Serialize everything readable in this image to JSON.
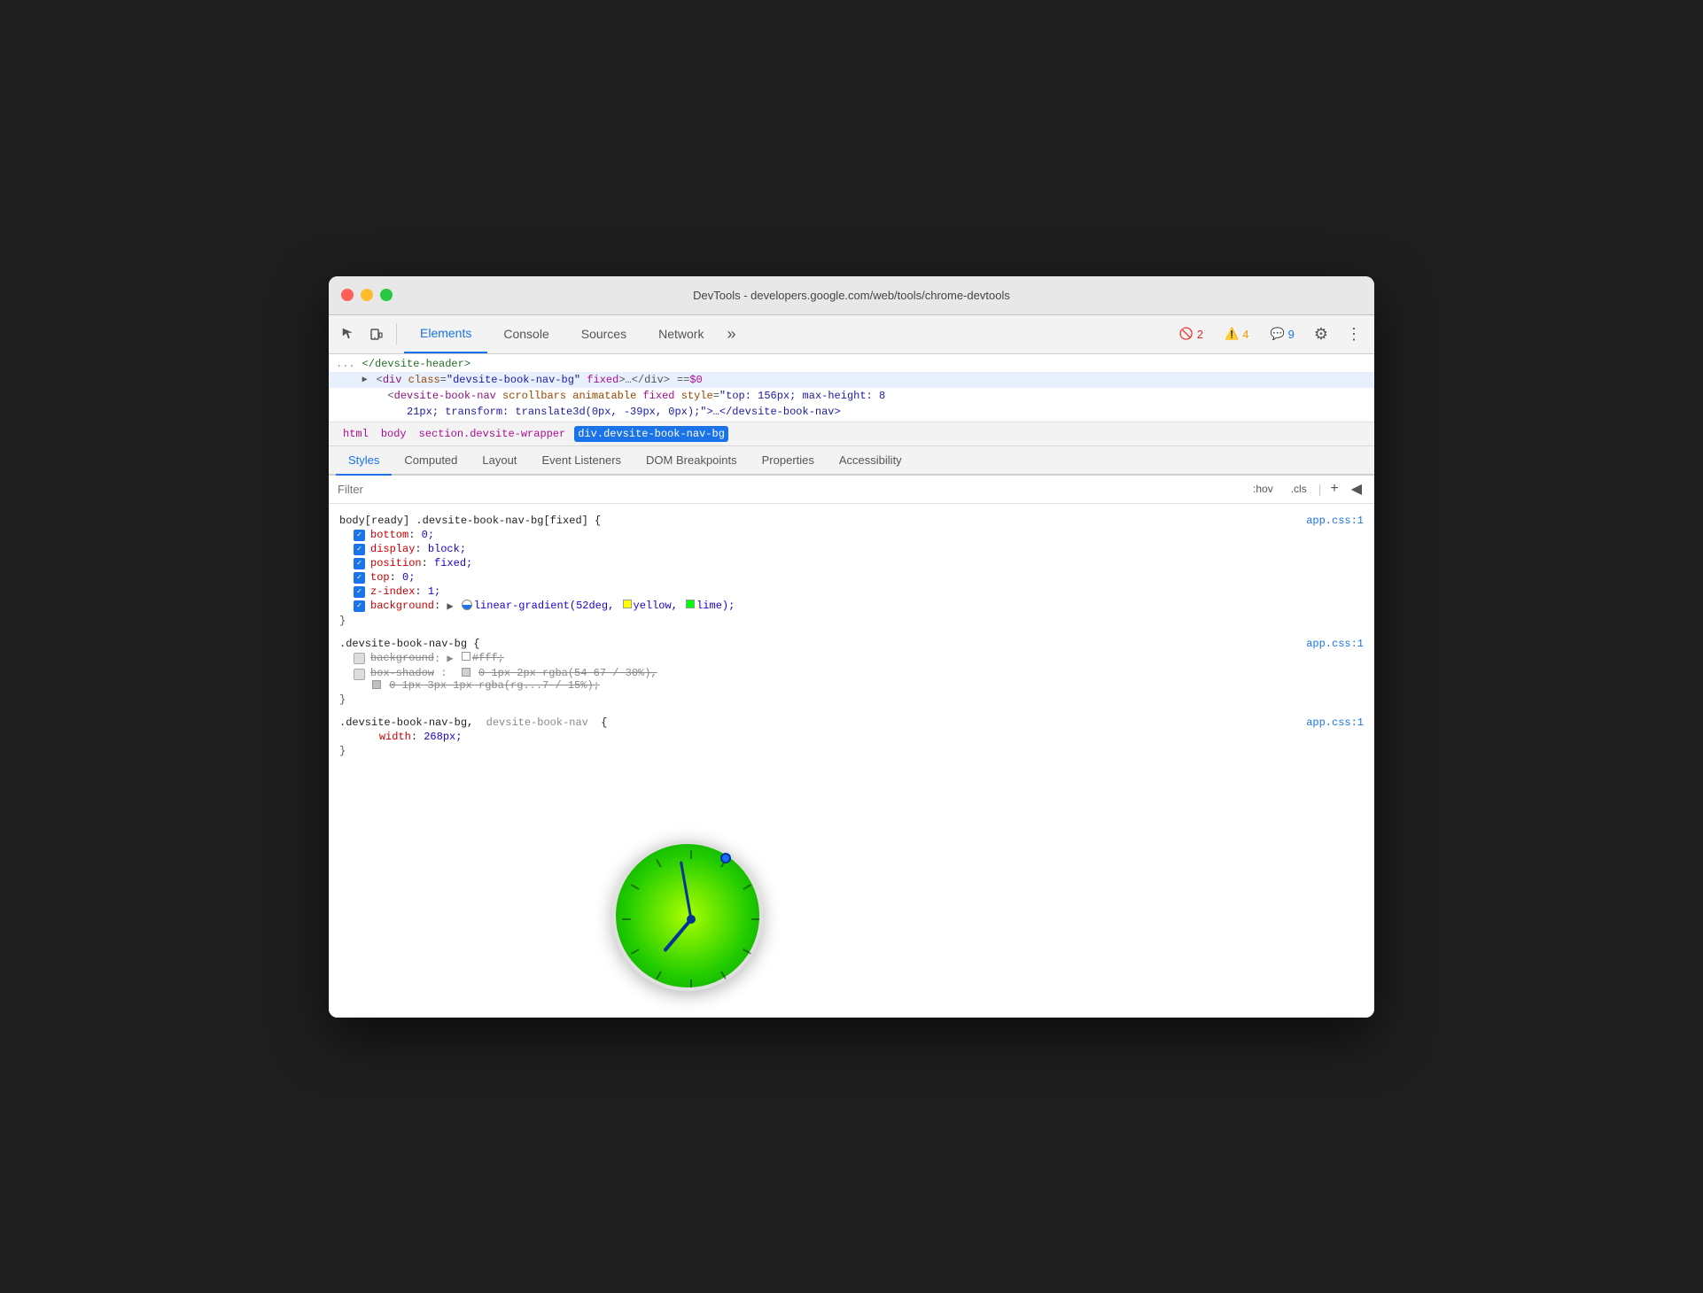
{
  "window": {
    "title": "DevTools - developers.google.com/web/tools/chrome-devtools"
  },
  "toolbar": {
    "tabs": [
      {
        "id": "elements",
        "label": "Elements",
        "active": true
      },
      {
        "id": "console",
        "label": "Console",
        "active": false
      },
      {
        "id": "sources",
        "label": "Sources",
        "active": false
      },
      {
        "id": "network",
        "label": "Network",
        "active": false
      }
    ],
    "more_label": "»",
    "errors_count": "2",
    "warnings_count": "4",
    "messages_count": "9",
    "settings_icon": "⚙",
    "more_icon": "⋮"
  },
  "html_panel": {
    "line1": "</devsite-header>",
    "line2_prefix": "▶",
    "line2_tag": "div",
    "line2_attr": "class",
    "line2_val": "devsite-book-nav-bg",
    "line2_keyword": "fixed",
    "line2_comment": "…</div>",
    "line2_eq": "== $0",
    "line3_tag": "devsite-book-nav",
    "line3_attrs": "scrollbars animatable fixed",
    "line3_style_attr": "style",
    "line3_style_val": "\"top: 156px; max-height: 8",
    "line4": "21px; transform: translate3d(0px, -39px, 0px);\">…</devsite-book-nav>"
  },
  "breadcrumb": {
    "items": [
      {
        "label": "html",
        "selected": false
      },
      {
        "label": "body",
        "selected": false
      },
      {
        "label": "section.devsite-wrapper",
        "selected": false
      },
      {
        "label": "div.devsite-book-nav-bg",
        "selected": true
      }
    ]
  },
  "sub_tabs": {
    "tabs": [
      {
        "label": "Styles",
        "active": true
      },
      {
        "label": "Computed",
        "active": false
      },
      {
        "label": "Layout",
        "active": false
      },
      {
        "label": "Event Listeners",
        "active": false
      },
      {
        "label": "DOM Breakpoints",
        "active": false
      },
      {
        "label": "Properties",
        "active": false
      },
      {
        "label": "Accessibility",
        "active": false
      }
    ]
  },
  "filter_bar": {
    "placeholder": "Filter",
    "hov_label": ":hov",
    "cls_label": ".cls",
    "plus_label": "+",
    "arrow_label": "◀"
  },
  "css_rules": [
    {
      "selector": "body[ready] .devsite-book-nav-bg[fixed] {",
      "source": "app.css:1",
      "properties": [
        {
          "checked": true,
          "name": "bottom",
          "value": "0;"
        },
        {
          "checked": true,
          "name": "display",
          "value": "block;"
        },
        {
          "checked": true,
          "name": "position",
          "value": "fixed;"
        },
        {
          "checked": true,
          "name": "top",
          "value": "0;"
        },
        {
          "checked": true,
          "name": "z-index",
          "value": "1;"
        },
        {
          "checked": true,
          "name": "background",
          "value": "linear-gradient(52deg, yellow, lime);",
          "has_gradient": true
        }
      ]
    },
    {
      "selector": ".devsite-book-nav-bg {",
      "source": "app.css:1",
      "properties": [
        {
          "checked": false,
          "name": "background",
          "value": "#fff;",
          "strikethrough": true,
          "has_swatch": true,
          "swatch_color": "#ffffff"
        },
        {
          "checked": false,
          "name": "box-shadow",
          "value": "0 1px 2px rgba(54 67 / 30%),\n0 1px 3px 1px rgba(rg...7 / 15%);",
          "strikethrough": true,
          "multiline": true
        }
      ]
    },
    {
      "selector": ".devsite-book-nav-bg, devsite-book-nav {",
      "source": "app.css:1",
      "properties": [
        {
          "checked": false,
          "name": "width",
          "value": "268px;"
        }
      ]
    }
  ],
  "clock": {
    "visible": true
  }
}
